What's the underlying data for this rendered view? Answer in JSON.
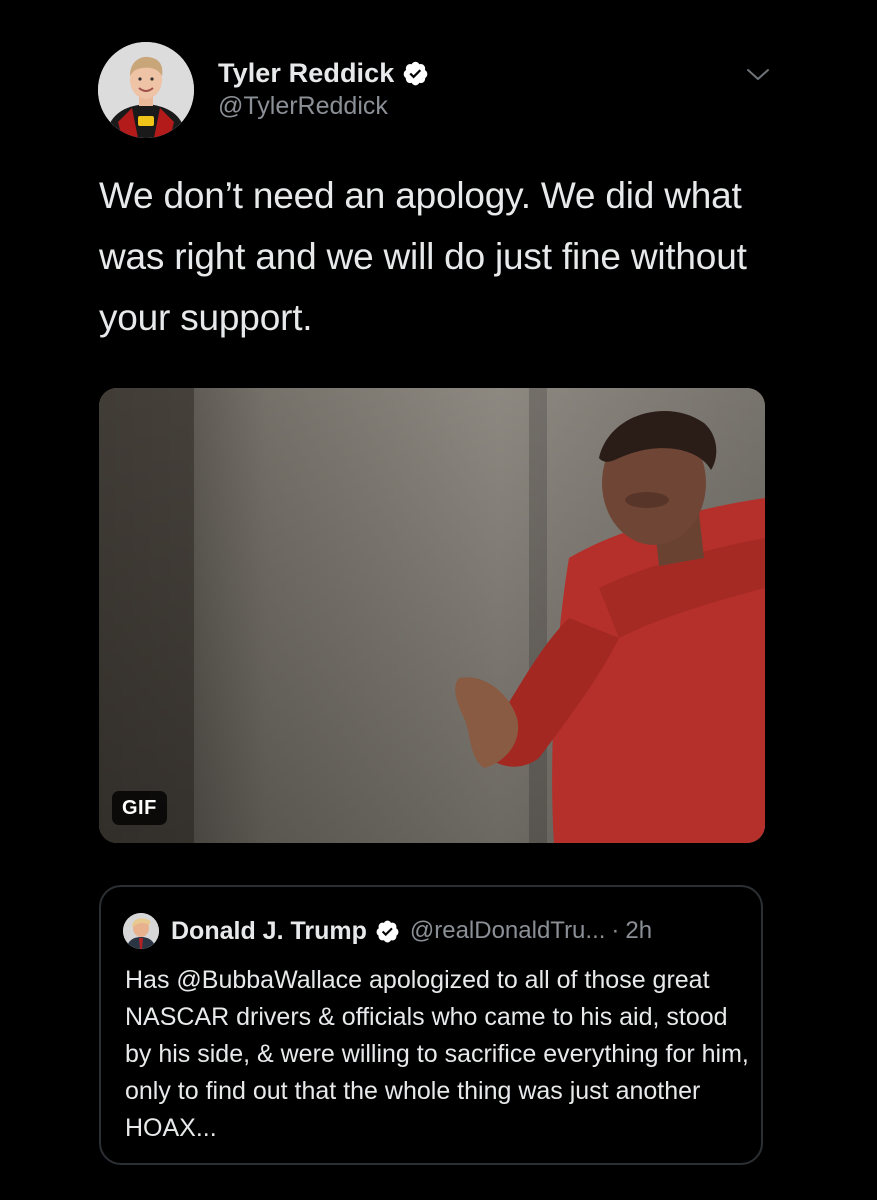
{
  "tweet": {
    "author": {
      "display_name": "Tyler Reddick",
      "handle": "@TylerReddick",
      "verified": true
    },
    "text": "We don’t need an apology. We did what was right and we will do just fine without your support.",
    "media": {
      "type": "gif",
      "badge": "GIF"
    }
  },
  "quoted_tweet": {
    "author": {
      "display_name": "Donald J. Trump",
      "handle": "@realDonaldTru...",
      "verified": true
    },
    "separator": "·",
    "time": "2h",
    "text": "Has @BubbaWallace apologized to all of those great NASCAR drivers & officials who came to his aid, stood by his side, & were willing to sacrifice everything for him, only to find out that the whole thing was just another HOAX..."
  },
  "icons": {
    "verified": "verified-badge-icon",
    "more": "chevron-down-icon"
  },
  "colors": {
    "background": "#000000",
    "text_primary": "#e7e9ea",
    "text_secondary": "#8b9096",
    "verified": "#ffffff",
    "card_border": "#2b2f33"
  }
}
